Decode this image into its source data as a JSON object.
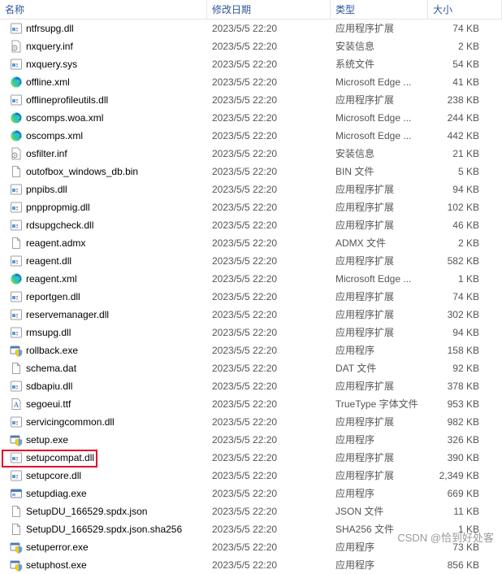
{
  "columns": {
    "name": "名称",
    "date": "修改日期",
    "type": "类型",
    "size": "大小"
  },
  "highlight_index": 18,
  "watermark": "CSDN @恰到好处客",
  "files": [
    {
      "name": "ntfrsupg.dll",
      "date": "2023/5/5 22:20",
      "type": "应用程序扩展",
      "size": "74 KB",
      "icon": "dll"
    },
    {
      "name": "nxquery.inf",
      "date": "2023/5/5 22:20",
      "type": "安装信息",
      "size": "2 KB",
      "icon": "inf"
    },
    {
      "name": "nxquery.sys",
      "date": "2023/5/5 22:20",
      "type": "系统文件",
      "size": "54 KB",
      "icon": "sys"
    },
    {
      "name": "offline.xml",
      "date": "2023/5/5 22:20",
      "type": "Microsoft Edge ...",
      "size": "41 KB",
      "icon": "edge"
    },
    {
      "name": "offlineprofileutils.dll",
      "date": "2023/5/5 22:20",
      "type": "应用程序扩展",
      "size": "238 KB",
      "icon": "dll"
    },
    {
      "name": "oscomps.woa.xml",
      "date": "2023/5/5 22:20",
      "type": "Microsoft Edge ...",
      "size": "244 KB",
      "icon": "edge"
    },
    {
      "name": "oscomps.xml",
      "date": "2023/5/5 22:20",
      "type": "Microsoft Edge ...",
      "size": "442 KB",
      "icon": "edge"
    },
    {
      "name": "osfilter.inf",
      "date": "2023/5/5 22:20",
      "type": "安装信息",
      "size": "21 KB",
      "icon": "inf"
    },
    {
      "name": "outofbox_windows_db.bin",
      "date": "2023/5/5 22:20",
      "type": "BIN 文件",
      "size": "5 KB",
      "icon": "file"
    },
    {
      "name": "pnpibs.dll",
      "date": "2023/5/5 22:20",
      "type": "应用程序扩展",
      "size": "94 KB",
      "icon": "dll"
    },
    {
      "name": "pnppropmig.dll",
      "date": "2023/5/5 22:20",
      "type": "应用程序扩展",
      "size": "102 KB",
      "icon": "dll"
    },
    {
      "name": "rdsupgcheck.dll",
      "date": "2023/5/5 22:20",
      "type": "应用程序扩展",
      "size": "46 KB",
      "icon": "dll"
    },
    {
      "name": "reagent.admx",
      "date": "2023/5/5 22:20",
      "type": "ADMX 文件",
      "size": "2 KB",
      "icon": "file"
    },
    {
      "name": "reagent.dll",
      "date": "2023/5/5 22:20",
      "type": "应用程序扩展",
      "size": "582 KB",
      "icon": "dll"
    },
    {
      "name": "reagent.xml",
      "date": "2023/5/5 22:20",
      "type": "Microsoft Edge ...",
      "size": "1 KB",
      "icon": "edge"
    },
    {
      "name": "reportgen.dll",
      "date": "2023/5/5 22:20",
      "type": "应用程序扩展",
      "size": "74 KB",
      "icon": "dll"
    },
    {
      "name": "reservemanager.dll",
      "date": "2023/5/5 22:20",
      "type": "应用程序扩展",
      "size": "302 KB",
      "icon": "dll"
    },
    {
      "name": "rmsupg.dll",
      "date": "2023/5/5 22:20",
      "type": "应用程序扩展",
      "size": "94 KB",
      "icon": "dll"
    },
    {
      "name": "rollback.exe",
      "date": "2023/5/5 22:20",
      "type": "应用程序",
      "size": "158 KB",
      "icon": "exe-shield"
    },
    {
      "name": "schema.dat",
      "date": "2023/5/5 22:20",
      "type": "DAT 文件",
      "size": "92 KB",
      "icon": "file"
    },
    {
      "name": "sdbapiu.dll",
      "date": "2023/5/5 22:20",
      "type": "应用程序扩展",
      "size": "378 KB",
      "icon": "dll"
    },
    {
      "name": "segoeui.ttf",
      "date": "2023/5/5 22:20",
      "type": "TrueType 字体文件",
      "size": "953 KB",
      "icon": "font"
    },
    {
      "name": "servicingcommon.dll",
      "date": "2023/5/5 22:20",
      "type": "应用程序扩展",
      "size": "982 KB",
      "icon": "dll"
    },
    {
      "name": "setup.exe",
      "date": "2023/5/5 22:20",
      "type": "应用程序",
      "size": "326 KB",
      "icon": "exe-shield"
    },
    {
      "name": "setupcompat.dll",
      "date": "2023/5/5 22:20",
      "type": "应用程序扩展",
      "size": "390 KB",
      "icon": "dll"
    },
    {
      "name": "setupcore.dll",
      "date": "2023/5/5 22:20",
      "type": "应用程序扩展",
      "size": "2,349 KB",
      "icon": "dll"
    },
    {
      "name": "setupdiag.exe",
      "date": "2023/5/5 22:20",
      "type": "应用程序",
      "size": "669 KB",
      "icon": "exe"
    },
    {
      "name": "SetupDU_166529.spdx.json",
      "date": "2023/5/5 22:20",
      "type": "JSON 文件",
      "size": "11 KB",
      "icon": "file"
    },
    {
      "name": "SetupDU_166529.spdx.json.sha256",
      "date": "2023/5/5 22:20",
      "type": "SHA256 文件",
      "size": "1 KB",
      "icon": "file"
    },
    {
      "name": "setuperror.exe",
      "date": "2023/5/5 22:20",
      "type": "应用程序",
      "size": "73 KB",
      "icon": "exe-shield"
    },
    {
      "name": "setuphost.exe",
      "date": "2023/5/5 22:20",
      "type": "应用程序",
      "size": "856 KB",
      "icon": "exe-shield"
    }
  ]
}
